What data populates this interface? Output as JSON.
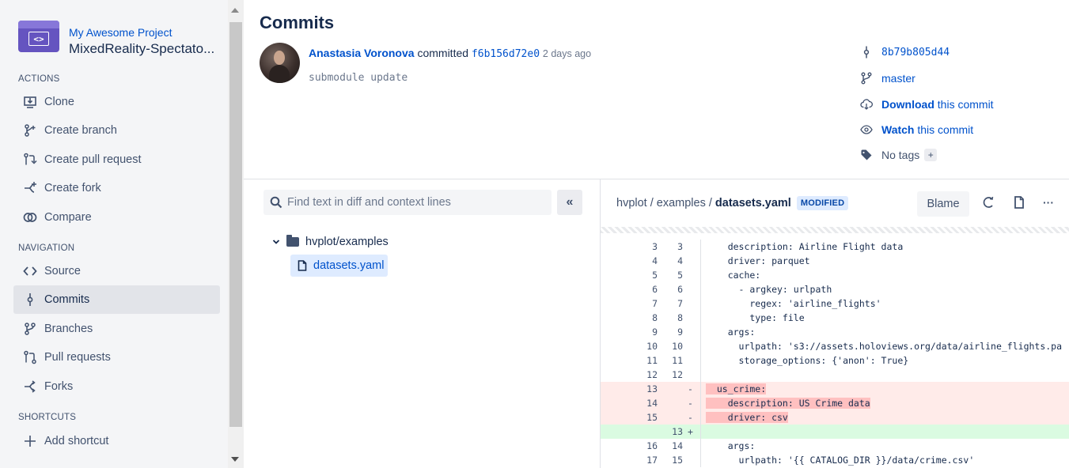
{
  "project": {
    "name": "My Awesome Project",
    "repo": "MixedReality-Spectato...",
    "avatar_glyph": "<>"
  },
  "sidebar": {
    "actions_title": "ACTIONS",
    "actions": [
      {
        "label": "Clone",
        "icon": "clone-icon"
      },
      {
        "label": "Create branch",
        "icon": "create-branch-icon"
      },
      {
        "label": "Create pull request",
        "icon": "create-pull-request-icon"
      },
      {
        "label": "Create fork",
        "icon": "create-fork-icon"
      },
      {
        "label": "Compare",
        "icon": "compare-icon"
      }
    ],
    "navigation_title": "NAVIGATION",
    "navigation": [
      {
        "label": "Source",
        "icon": "source-icon"
      },
      {
        "label": "Commits",
        "icon": "commit-icon",
        "active": true
      },
      {
        "label": "Branches",
        "icon": "branches-icon"
      },
      {
        "label": "Pull requests",
        "icon": "pull-requests-icon"
      },
      {
        "label": "Forks",
        "icon": "forks-icon"
      }
    ],
    "shortcuts_title": "SHORTCUTS",
    "shortcuts": [
      {
        "label": "Add shortcut",
        "icon": "plus-icon"
      }
    ]
  },
  "header": {
    "title": "Commits",
    "author": "Anastasia Voronova",
    "committed_word": "committed",
    "hash": "f6b156d72e0",
    "when": "2 days ago",
    "message": "submodule update"
  },
  "meta": {
    "parent_hash": "8b79b805d44",
    "branch": "master",
    "download_bold": "Download",
    "download_rest": "this commit",
    "watch_bold": "Watch",
    "watch_rest": "this commit",
    "tags": "No tags",
    "tags_add": "+"
  },
  "files": {
    "search_placeholder": "Find text in diff and context lines",
    "collapse_label": "«",
    "folder": "hvplot/examples",
    "file": "datasets.yaml"
  },
  "diff": {
    "path_prefix": "hvplot / examples / ",
    "filename": "datasets.yaml",
    "status_badge": "MODIFIED",
    "blame_label": "Blame",
    "more_label": "···",
    "lines": [
      {
        "old": "3",
        "new": "3",
        "mark": "",
        "type": "ctx",
        "text": "    description: Airline Flight data"
      },
      {
        "old": "4",
        "new": "4",
        "mark": "",
        "type": "ctx",
        "text": "    driver: parquet"
      },
      {
        "old": "5",
        "new": "5",
        "mark": "",
        "type": "ctx",
        "text": "    cache:"
      },
      {
        "old": "6",
        "new": "6",
        "mark": "",
        "type": "ctx",
        "text": "      - argkey: urlpath"
      },
      {
        "old": "7",
        "new": "7",
        "mark": "",
        "type": "ctx",
        "text": "        regex: 'airline_flights'"
      },
      {
        "old": "8",
        "new": "8",
        "mark": "",
        "type": "ctx",
        "text": "        type: file"
      },
      {
        "old": "9",
        "new": "9",
        "mark": "",
        "type": "ctx",
        "text": "    args:"
      },
      {
        "old": "10",
        "new": "10",
        "mark": "",
        "type": "ctx",
        "text": "      urlpath: 's3://assets.holoviews.org/data/airline_flights.pa"
      },
      {
        "old": "11",
        "new": "11",
        "mark": "",
        "type": "ctx",
        "text": "      storage_options: {'anon': True}"
      },
      {
        "old": "12",
        "new": "12",
        "mark": "",
        "type": "ctx",
        "text": ""
      },
      {
        "old": "13",
        "new": "",
        "mark": "-",
        "type": "del",
        "text": "  us_crime:"
      },
      {
        "old": "14",
        "new": "",
        "mark": "-",
        "type": "del",
        "text": "    description: US Crime data"
      },
      {
        "old": "15",
        "new": "",
        "mark": "-",
        "type": "del",
        "text": "    driver: csv"
      },
      {
        "old": "",
        "new": "13",
        "mark": "+",
        "type": "add",
        "text": ""
      },
      {
        "old": "16",
        "new": "14",
        "mark": "",
        "type": "ctx",
        "text": "    args:"
      },
      {
        "old": "17",
        "new": "15",
        "mark": "",
        "type": "ctx",
        "text": "      urlpath: '{{ CATALOG_DIR }}/data/crime.csv'"
      }
    ]
  }
}
